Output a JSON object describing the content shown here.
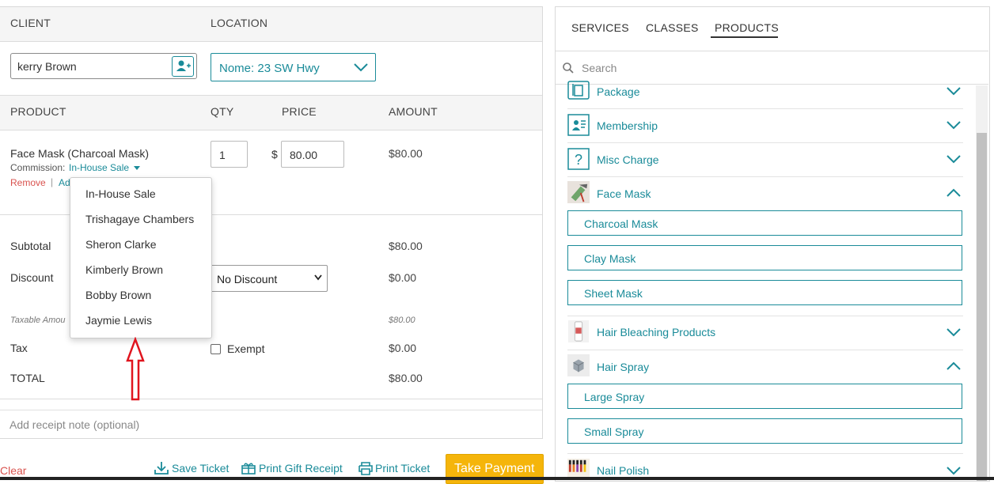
{
  "left": {
    "client_header": "CLIENT",
    "location_header": "LOCATION",
    "client_value": "kerry Brown",
    "location_value": "Nome: 23 SW Hwy",
    "product_header": "PRODUCT",
    "qty_header": "QTY",
    "price_header": "PRICE",
    "amount_header": "AMOUNT",
    "item": {
      "name": "Face Mask (Charcoal Mask)",
      "commission_label": "Commission:",
      "commission_value": "In-House Sale",
      "remove": "Remove",
      "separator": "|",
      "add_partial": "Ad",
      "qty": "1",
      "currency": "$",
      "price": "80.00",
      "amount": "$80.00"
    },
    "commission_menu": [
      "In-House Sale",
      "Trishagaye Chambers",
      "Sheron Clarke",
      "Kimberly Brown",
      "Bobby Brown",
      "Jaymie Lewis"
    ],
    "summary": {
      "subtotal_label": "Subtotal",
      "subtotal_value": "$80.00",
      "discount_label": "Discount",
      "discount_select": "No Discount",
      "discount_value": "$0.00",
      "taxable_label": "Taxable Amou",
      "taxable_value": "$80.00",
      "tax_label": "Tax",
      "exempt_label": "Exempt",
      "tax_value": "$0.00",
      "total_label": "TOTAL",
      "total_value": "$80.00"
    },
    "receipt_note_placeholder": "Add receipt note (optional)"
  },
  "bottom": {
    "clear": "Clear",
    "save_ticket": "Save Ticket",
    "print_gift_receipt": "Print Gift Receipt",
    "print_ticket": "Print Ticket",
    "take_payment": "Take Payment"
  },
  "right": {
    "tabs": [
      "SERVICES",
      "CLASSES",
      "PRODUCTS"
    ],
    "active_tab": "PRODUCTS",
    "search_placeholder": "Search",
    "categories": [
      {
        "name": "Package",
        "icon": "package-icon",
        "expanded": false
      },
      {
        "name": "Membership",
        "icon": "membership-icon",
        "expanded": false
      },
      {
        "name": "Misc Charge",
        "icon": "question-icon",
        "expanded": false
      },
      {
        "name": "Face Mask",
        "icon": "face-mask-image",
        "expanded": true,
        "items": [
          "Charcoal Mask",
          "Clay Mask",
          "Sheet Mask"
        ]
      },
      {
        "name": "Hair Bleaching Products",
        "icon": "bleach-bottle-image",
        "expanded": false
      },
      {
        "name": "Hair Spray",
        "icon": "box-icon",
        "expanded": true,
        "items": [
          "Large Spray",
          "Small Spray"
        ]
      },
      {
        "name": "Nail Polish",
        "icon": "nail-polish-image",
        "expanded": false
      }
    ]
  },
  "colors": {
    "accent": "#1a8b99",
    "pay_button": "#f5b50b",
    "remove": "#d9534f",
    "arrow": "#e0141e"
  }
}
